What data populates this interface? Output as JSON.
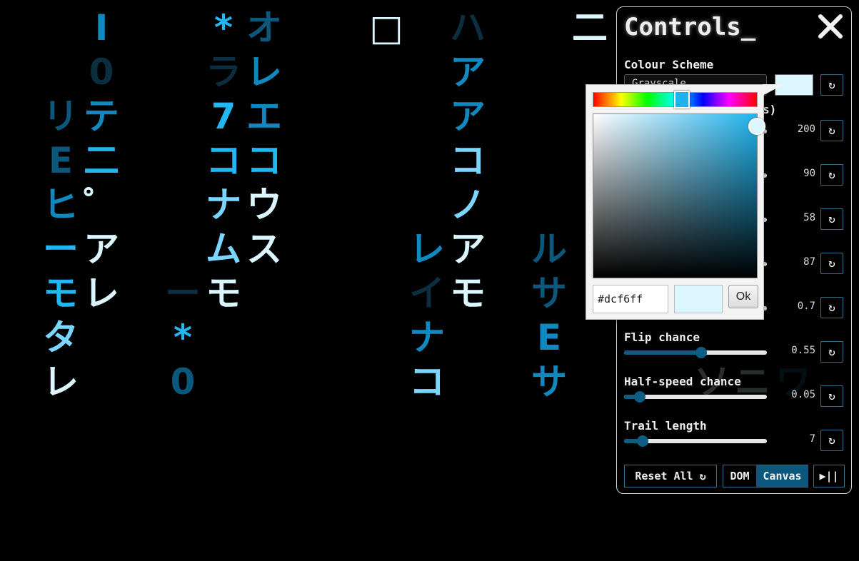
{
  "rain": {
    "colors": {
      "bright": "#dcf6ff",
      "light": "#7bd6ff",
      "cyan": "#22b7f2",
      "mid": "#0f89bf",
      "dark": "#0b587c",
      "faint": "#0b2e40"
    },
    "glyphs": [
      {
        "ch": "I",
        "c": "mid",
        "col": 2,
        "row": 0
      },
      {
        "ch": "*",
        "c": "cyan",
        "col": 5,
        "row": 0
      },
      {
        "ch": "オ",
        "c": "dark",
        "col": 6,
        "row": 0
      },
      {
        "ch": "□",
        "c": "bright",
        "col": 9,
        "row": 0
      },
      {
        "ch": "ハ",
        "c": "faint",
        "col": 11,
        "row": 0
      },
      {
        "ch": "二",
        "c": "bright",
        "col": 14,
        "row": 0
      },
      {
        "ch": "0",
        "c": "faint",
        "col": 2,
        "row": 1
      },
      {
        "ch": "ラ",
        "c": "faint",
        "col": 5,
        "row": 1
      },
      {
        "ch": "レ",
        "c": "mid",
        "col": 6,
        "row": 1
      },
      {
        "ch": "ア",
        "c": "mid",
        "col": 11,
        "row": 1
      },
      {
        "ch": "リ",
        "c": "dark",
        "col": 1,
        "row": 2
      },
      {
        "ch": "テ",
        "c": "mid",
        "col": 2,
        "row": 2
      },
      {
        "ch": "7",
        "c": "cyan",
        "col": 5,
        "row": 2
      },
      {
        "ch": "エ",
        "c": "mid",
        "col": 6,
        "row": 2
      },
      {
        "ch": "ア",
        "c": "mid",
        "col": 11,
        "row": 2
      },
      {
        "ch": "E",
        "c": "dark",
        "col": 1,
        "row": 3
      },
      {
        "ch": "二",
        "c": "cyan",
        "col": 2,
        "row": 3
      },
      {
        "ch": "コ",
        "c": "cyan",
        "col": 5,
        "row": 3
      },
      {
        "ch": "コ",
        "c": "cyan",
        "col": 6,
        "row": 3
      },
      {
        "ch": "コ",
        "c": "light",
        "col": 11,
        "row": 3
      },
      {
        "ch": "ヒ",
        "c": "mid",
        "col": 1,
        "row": 4
      },
      {
        "ch": "゜",
        "c": "bright",
        "col": 2,
        "row": 4
      },
      {
        "ch": "ナ",
        "c": "light",
        "col": 5,
        "row": 4
      },
      {
        "ch": "ウ",
        "c": "bright",
        "col": 6,
        "row": 4
      },
      {
        "ch": "ノ",
        "c": "light",
        "col": 11,
        "row": 4
      },
      {
        "ch": "ー",
        "c": "cyan",
        "col": 1,
        "row": 5
      },
      {
        "ch": "ア",
        "c": "bright",
        "col": 2,
        "row": 5
      },
      {
        "ch": "ム",
        "c": "light",
        "col": 5,
        "row": 5
      },
      {
        "ch": "ス",
        "c": "bright",
        "col": 6,
        "row": 5
      },
      {
        "ch": "レ",
        "c": "mid",
        "col": 10,
        "row": 5
      },
      {
        "ch": "ア",
        "c": "bright",
        "col": 11,
        "row": 5
      },
      {
        "ch": "ル",
        "c": "dark",
        "col": 13,
        "row": 5
      },
      {
        "ch": "モ",
        "c": "cyan",
        "col": 1,
        "row": 6
      },
      {
        "ch": "レ",
        "c": "bright",
        "col": 2,
        "row": 6
      },
      {
        "ch": "ー",
        "c": "faint",
        "col": 4,
        "row": 6
      },
      {
        "ch": "モ",
        "c": "bright",
        "col": 5,
        "row": 6
      },
      {
        "ch": "イ",
        "c": "faint",
        "col": 10,
        "row": 6
      },
      {
        "ch": "モ",
        "c": "bright",
        "col": 11,
        "row": 6
      },
      {
        "ch": "サ",
        "c": "dark",
        "col": 13,
        "row": 6
      },
      {
        "ch": "タ",
        "c": "light",
        "col": 1,
        "row": 7
      },
      {
        "ch": "*",
        "c": "cyan",
        "col": 4,
        "row": 7
      },
      {
        "ch": "ナ",
        "c": "mid",
        "col": 10,
        "row": 7
      },
      {
        "ch": "E",
        "c": "mid",
        "col": 13,
        "row": 7
      },
      {
        "ch": "レ",
        "c": "bright",
        "col": 1,
        "row": 8
      },
      {
        "ch": "0",
        "c": "dark",
        "col": 4,
        "row": 8
      },
      {
        "ch": "コ",
        "c": "light",
        "col": 10,
        "row": 8
      },
      {
        "ch": "サ",
        "c": "mid",
        "col": 13,
        "row": 8
      },
      {
        "ch": "ソ",
        "c": "bright",
        "col": 17,
        "row": 8
      },
      {
        "ch": "ニ",
        "c": "bright",
        "col": 18,
        "row": 8
      },
      {
        "ch": "ワ",
        "c": "dark",
        "col": 19,
        "row": 8
      }
    ]
  },
  "panel": {
    "title": "Controls_",
    "close_icon": "close-icon",
    "colour_scheme": {
      "label": "Colour Scheme",
      "selected": "Grayscale",
      "swatch_color": "#dcf6ff"
    },
    "hidden_label_fragment": "s)",
    "sliders": [
      {
        "label": "",
        "value": "200",
        "fraction": 0.7
      },
      {
        "label": "",
        "value": "90",
        "fraction": 0.62
      },
      {
        "label": "",
        "value": "58",
        "fraction": 0.6
      },
      {
        "label": "",
        "value": "87",
        "fraction": 0.64
      },
      {
        "label": "",
        "value": "0.7",
        "fraction": 0.7
      },
      {
        "label": "Flip chance",
        "value": "0.55",
        "fraction": 0.54
      },
      {
        "label": "Half-speed chance",
        "value": "0.05",
        "fraction": 0.11
      },
      {
        "label": "Trail length",
        "value": "7",
        "fraction": 0.13
      }
    ],
    "reset_icon": "↻",
    "footer": {
      "reset_all": "Reset All ↻",
      "dom": "DOM",
      "canvas": "Canvas",
      "play_pause": "▶||"
    }
  },
  "picker": {
    "hex_value": "#dcf6ff",
    "preview_color": "#dcf6ff",
    "ok_label": "Ok",
    "hue_color": "#1fb3ee"
  }
}
